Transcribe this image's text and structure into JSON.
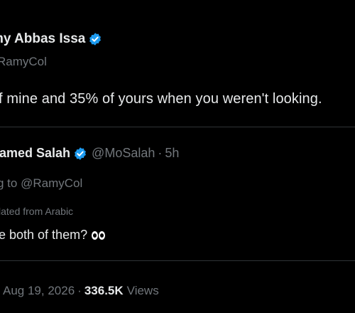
{
  "parent_tweet": {
    "display_name": "my Abbas Issa",
    "handle": "RamyCol",
    "text": "f mine and 35% of yours when you weren't looking."
  },
  "reply": {
    "display_name": "hamed Salah",
    "handle": "@MoSalah",
    "separator": "·",
    "time": "5h",
    "replying_prefix": "g to ",
    "replying_mention": "@RamyCol",
    "translated_label": "lated from Arabic",
    "text": "e both of them?",
    "emoji_icon": "eyes-emoji"
  },
  "meta": {
    "date": "Aug 19, 2026",
    "separator": "·",
    "views_count": "336.5K",
    "views_label": "Views"
  },
  "colors": {
    "background": "#000000",
    "primary_text": "#e7e9ea",
    "secondary_text": "#71767b",
    "verified_blue": "#1d9bf0",
    "divider": "#2f3336"
  }
}
